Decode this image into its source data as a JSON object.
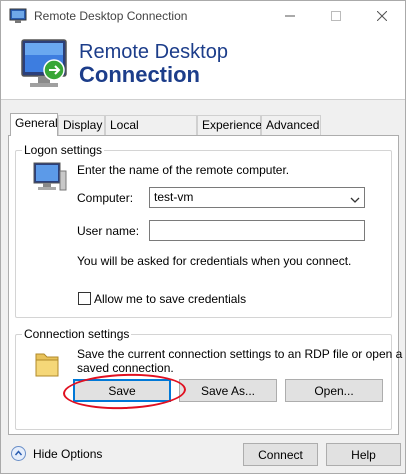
{
  "window": {
    "title": "Remote Desktop Connection",
    "icons": {
      "app": "computer-monitor-icon",
      "minimize": "minimize-icon",
      "maximize": "maximize-icon",
      "close": "close-icon"
    }
  },
  "banner": {
    "line1": "Remote Desktop",
    "line2": "Connection",
    "icon": "remote-desktop-monitor-icon"
  },
  "tabs": [
    {
      "label": "General",
      "active": true
    },
    {
      "label": "Display",
      "active": false
    },
    {
      "label": "Local Resources",
      "active": false
    },
    {
      "label": "Experience",
      "active": false
    },
    {
      "label": "Advanced",
      "active": false
    }
  ],
  "logon": {
    "group_label": "Logon settings",
    "instruction": "Enter the name of the remote computer.",
    "computer_label": "Computer:",
    "computer_value": "test-vm",
    "username_label": "User name:",
    "username_value": "",
    "credentials_note": "You will be asked for credentials when you connect.",
    "allow_save_label": "Allow me to save credentials",
    "allow_save_checked": false
  },
  "connection": {
    "group_label": "Connection settings",
    "description_line1": "Save the current connection settings to an RDP file or open a",
    "description_line2": "saved connection.",
    "save_label": "Save",
    "save_as_label": "Save As...",
    "open_label": "Open..."
  },
  "footer": {
    "hide_options_label": "Hide Options",
    "connect_label": "Connect",
    "help_label": "Help"
  },
  "colors": {
    "brand_text": "#1c3d8a",
    "annotation_circle": "#e01020",
    "default_button_border": "#0078d7"
  }
}
